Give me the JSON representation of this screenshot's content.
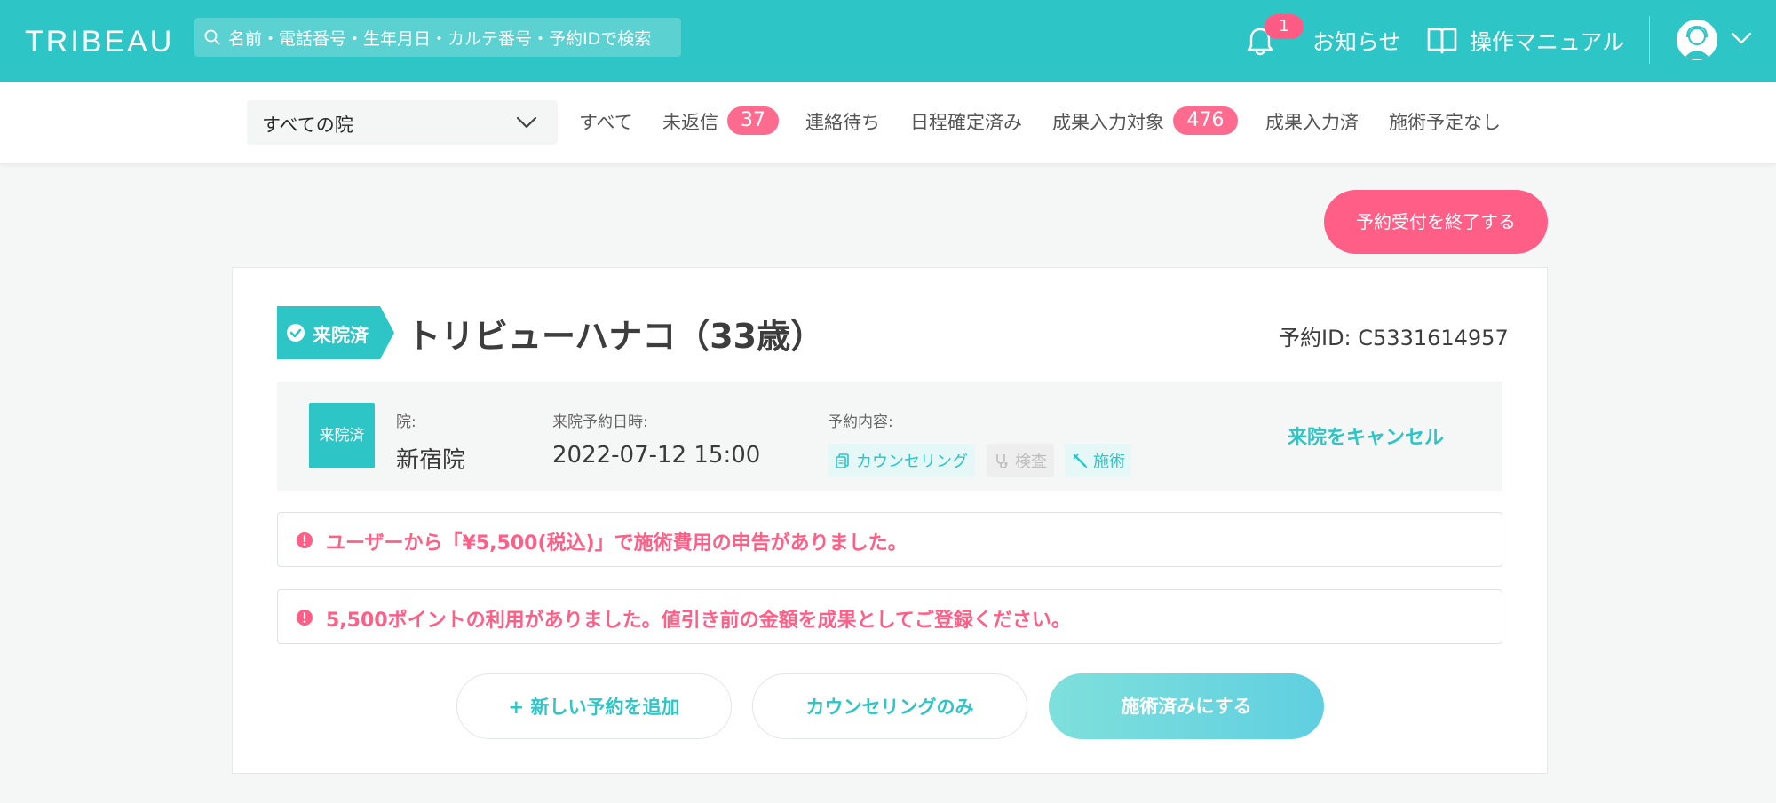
{
  "header": {
    "logo": "TRIBEAU",
    "search_placeholder": "名前・電話番号・生年月日・カルテ番号・予約IDで検索",
    "notifications_badge": "1",
    "notifications_label": "お知らせ",
    "manual_label": "操作マニュアル",
    "icons": [
      "search-icon",
      "bell-icon",
      "book-icon",
      "user-avatar",
      "chevron-down-icon"
    ]
  },
  "filter": {
    "clinic_select": "すべての院",
    "tabs": [
      {
        "label": "すべて"
      },
      {
        "label": "未返信",
        "badge": "37"
      },
      {
        "label": "連絡待ち"
      },
      {
        "label": "日程確定済み"
      },
      {
        "label": "成果入力対象",
        "badge": "476"
      },
      {
        "label": "成果入力済"
      },
      {
        "label": "施術予定なし"
      }
    ]
  },
  "actions": {
    "end_reception": "予約受付を終了する"
  },
  "reservation": {
    "status": "来院済",
    "patient_name": "トリビューハナコ（33歳）",
    "reservation_id": "予約ID: C5331614957",
    "visit_badge": "来院済",
    "clinic_label": "院:",
    "clinic_value": "新宿院",
    "datetime_label": "来院予約日時:",
    "datetime_value": "2022-07-12 15:00",
    "content_label": "予約内容:",
    "chips": [
      {
        "label": "カウンセリング",
        "active": true
      },
      {
        "label": "検査",
        "active": false
      },
      {
        "label": "施術",
        "active": true
      }
    ],
    "cancel_label": "来院をキャンセル",
    "alerts": [
      "ユーザーから「¥5,500(税込)」で施術費用の申告がありました。",
      "5,500ポイントの利用がありました。値引き前の金額を成果としてご登録ください。"
    ],
    "buttons": {
      "add_reservation": "+ 新しい予約を追加",
      "counseling_only": "カウンセリングのみ",
      "mark_treated": "施術済みにする"
    }
  },
  "colors": {
    "brand": "#2ec5c6",
    "accent_pink": "#ff5f86",
    "panel_gray": "#f5f6f6"
  }
}
